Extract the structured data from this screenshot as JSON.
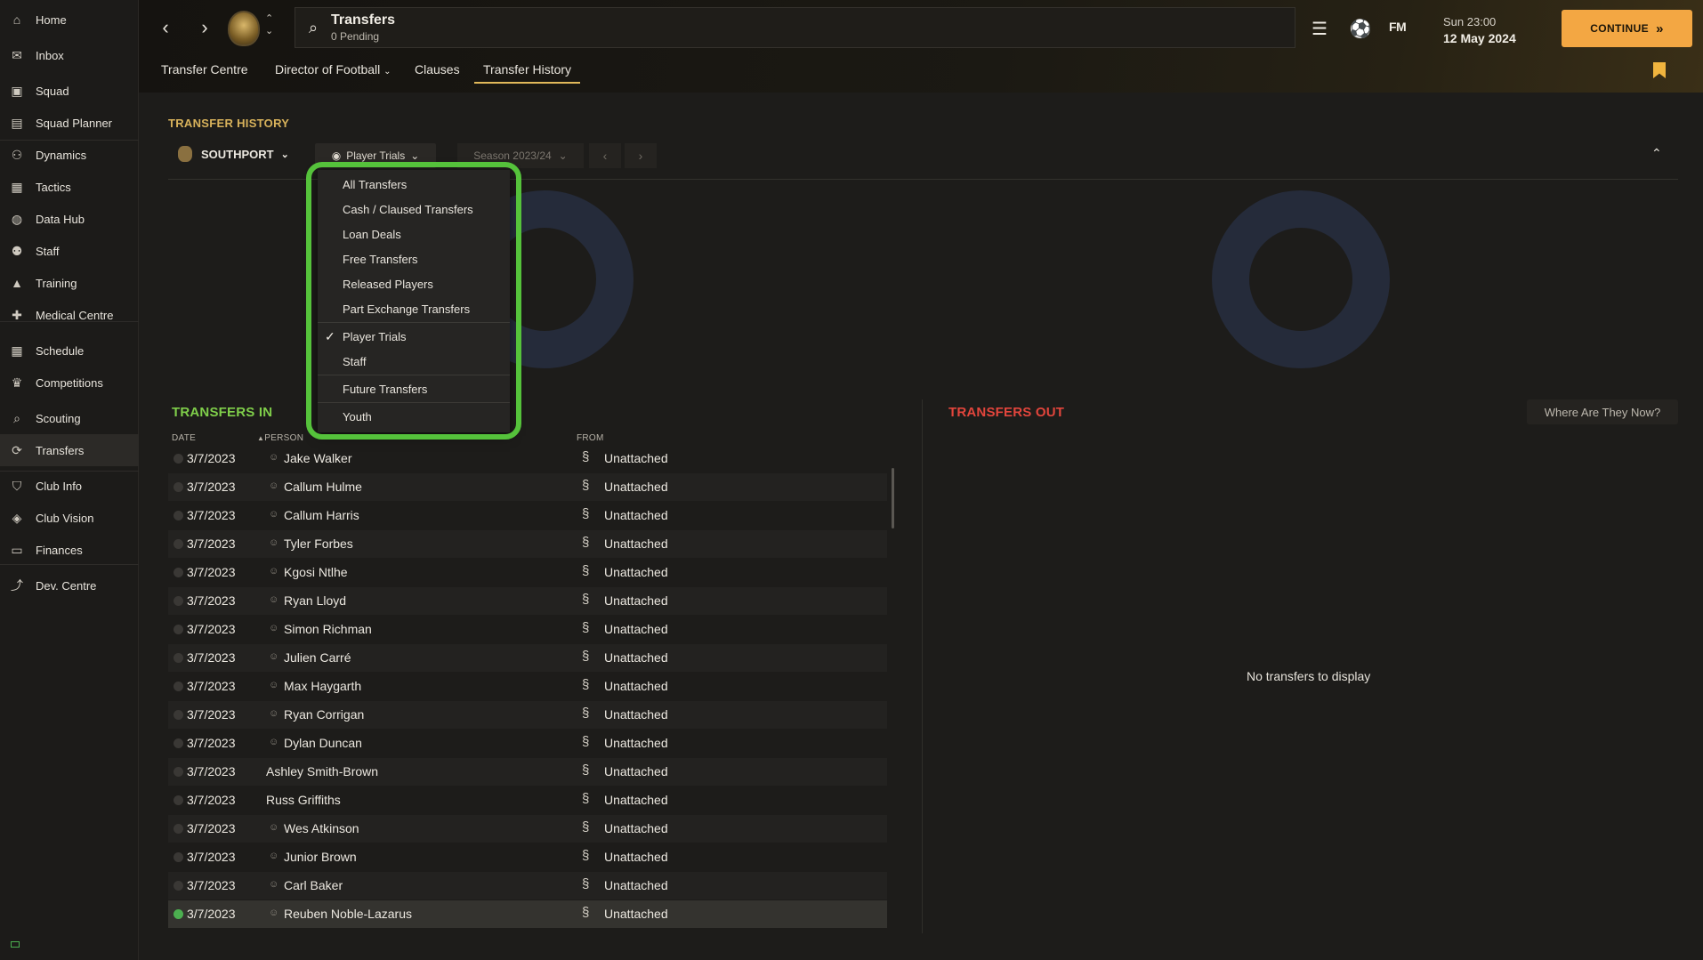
{
  "sidebar": {
    "items": [
      {
        "label": "Home",
        "icon": "home-icon"
      },
      {
        "label": "Inbox",
        "icon": "inbox-icon"
      },
      {
        "label": "Squad",
        "icon": "shirt-icon"
      },
      {
        "label": "Squad Planner",
        "icon": "planner-icon"
      },
      {
        "label": "Dynamics",
        "icon": "dynamics-icon"
      },
      {
        "label": "Tactics",
        "icon": "tactics-icon"
      },
      {
        "label": "Data Hub",
        "icon": "data-hub-icon"
      },
      {
        "label": "Staff",
        "icon": "staff-icon"
      },
      {
        "label": "Training",
        "icon": "training-icon"
      },
      {
        "label": "Medical Centre",
        "icon": "medical-icon"
      },
      {
        "label": "Schedule",
        "icon": "calendar-icon"
      },
      {
        "label": "Competitions",
        "icon": "trophy-icon"
      },
      {
        "label": "Scouting",
        "icon": "search-icon"
      },
      {
        "label": "Transfers",
        "icon": "transfers-icon"
      },
      {
        "label": "Club Info",
        "icon": "shield-icon"
      },
      {
        "label": "Club Vision",
        "icon": "vision-icon"
      },
      {
        "label": "Finances",
        "icon": "money-icon"
      },
      {
        "label": "Dev. Centre",
        "icon": "dev-centre-icon"
      }
    ],
    "active": "Transfers"
  },
  "header": {
    "search_title": "Transfers",
    "search_sub": "0 Pending",
    "fm_logo": "FM",
    "time": "Sun 23:00",
    "date": "12 May 2024",
    "continue_label": "CONTINUE"
  },
  "tabs": [
    {
      "label": "Transfer Centre"
    },
    {
      "label": "Director of Football"
    },
    {
      "label": "Clauses"
    },
    {
      "label": "Transfer History"
    }
  ],
  "history": {
    "title": "TRANSFER HISTORY",
    "club": "SOUTHPORT",
    "filter": "Player Trials",
    "season": "Season 2023/24"
  },
  "dropdown": {
    "items": [
      {
        "label": "All Transfers"
      },
      {
        "label": "Cash / Claused Transfers"
      },
      {
        "label": "Loan Deals"
      },
      {
        "label": "Free Transfers"
      },
      {
        "label": "Released Players"
      },
      {
        "label": "Part Exchange Transfers"
      },
      {
        "label": "Player Trials",
        "checked": true
      },
      {
        "label": "Staff"
      },
      {
        "label": "Future Transfers"
      },
      {
        "label": "Youth"
      }
    ]
  },
  "transfers_in": {
    "title": "TRANSFERS IN",
    "columns": {
      "date": "DATE",
      "person": "PERSON",
      "from": "FROM"
    },
    "rows": [
      {
        "date": "3/7/2023",
        "person": "Jake Walker",
        "from": "Unattached"
      },
      {
        "date": "3/7/2023",
        "person": "Callum Hulme",
        "from": "Unattached"
      },
      {
        "date": "3/7/2023",
        "person": "Callum Harris",
        "from": "Unattached"
      },
      {
        "date": "3/7/2023",
        "person": "Tyler Forbes",
        "from": "Unattached"
      },
      {
        "date": "3/7/2023",
        "person": "Kgosi Ntlhe",
        "from": "Unattached"
      },
      {
        "date": "3/7/2023",
        "person": "Ryan Lloyd",
        "from": "Unattached"
      },
      {
        "date": "3/7/2023",
        "person": "Simon Richman",
        "from": "Unattached"
      },
      {
        "date": "3/7/2023",
        "person": "Julien Carré",
        "from": "Unattached"
      },
      {
        "date": "3/7/2023",
        "person": "Max Haygarth",
        "from": "Unattached"
      },
      {
        "date": "3/7/2023",
        "person": "Ryan Corrigan",
        "from": "Unattached"
      },
      {
        "date": "3/7/2023",
        "person": "Dylan Duncan",
        "from": "Unattached"
      },
      {
        "date": "3/7/2023",
        "person": "Ashley Smith-Brown",
        "from": "Unattached",
        "no_icon": true
      },
      {
        "date": "3/7/2023",
        "person": "Russ Griffiths",
        "from": "Unattached",
        "no_icon": true
      },
      {
        "date": "3/7/2023",
        "person": "Wes Atkinson",
        "from": "Unattached"
      },
      {
        "date": "3/7/2023",
        "person": "Junior Brown",
        "from": "Unattached"
      },
      {
        "date": "3/7/2023",
        "person": "Carl Baker",
        "from": "Unattached"
      },
      {
        "date": "3/7/2023",
        "person": "Reuben Noble-Lazarus",
        "from": "Unattached",
        "selected": true
      }
    ]
  },
  "transfers_out": {
    "title": "TRANSFERS OUT",
    "where_label": "Where Are They Now?",
    "empty": "No transfers to display"
  },
  "colors": {
    "accent": "#f3a743",
    "section_title": "#d8b25b",
    "transfers_in": "#7fce4a",
    "transfers_out": "#e2453c",
    "highlight": "#55c23b"
  }
}
